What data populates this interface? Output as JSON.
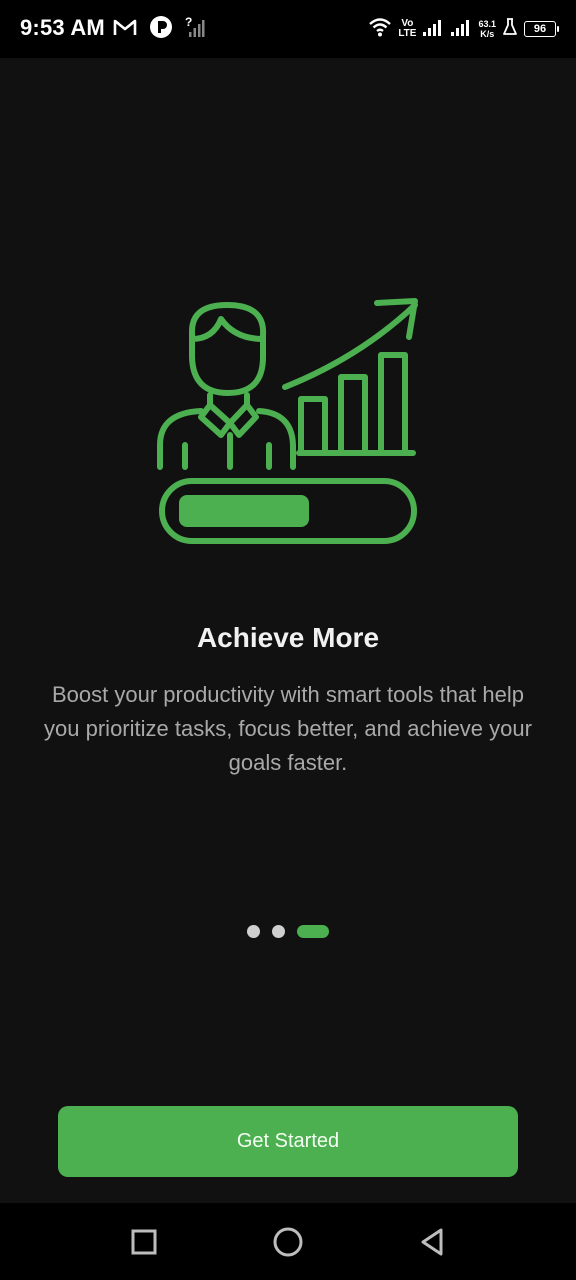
{
  "status_bar": {
    "time": "9:53 AM",
    "volte_top": "Vo",
    "volte_bottom": "LTE",
    "net_speed_value": "63.1",
    "net_speed_unit": "K/s",
    "battery": "96",
    "icons": [
      "gmail-icon",
      "app-notification-icon",
      "no-sim-signal-icon",
      "wifi-icon",
      "signal-icon",
      "signal-icon",
      "lab-flask-icon",
      "battery-icon"
    ]
  },
  "illustration": {
    "icon": "person-growth-progress-icon",
    "color": "#4caf50",
    "progress_fill": 0.55
  },
  "onboarding": {
    "title": "Achieve More",
    "description": "Boost your productivity with smart tools that help you prioritize tasks, focus better, and achieve your goals faster.",
    "page_count": 3,
    "active_page": 3
  },
  "cta": {
    "label": "Get Started",
    "color": "#4caf50"
  },
  "nav_bar": {
    "icons": [
      "recents-square-icon",
      "home-circle-icon",
      "back-triangle-icon"
    ]
  }
}
